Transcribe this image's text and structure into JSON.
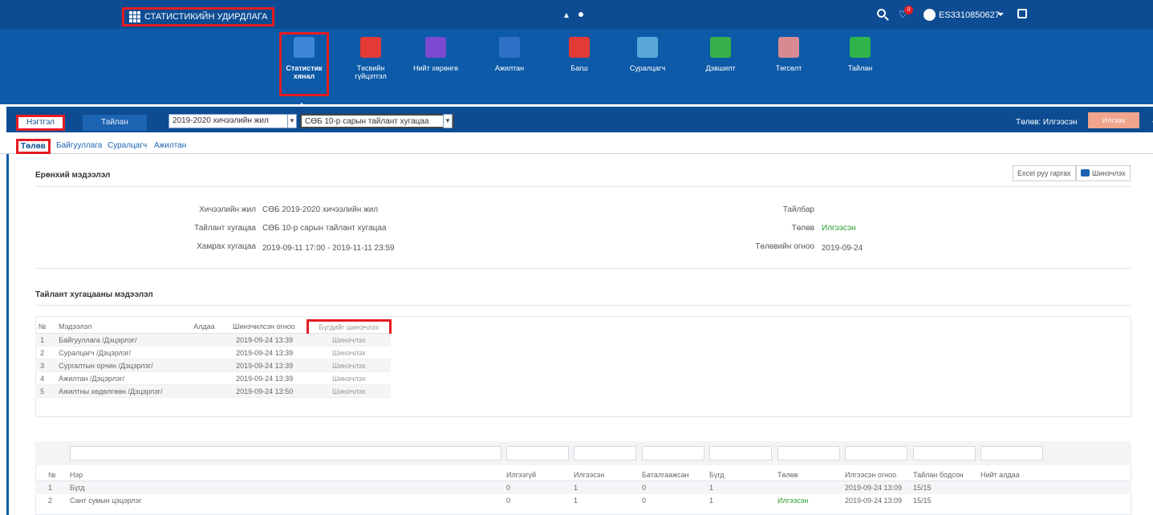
{
  "topbar": {
    "brand": "СТАТИСТИКИЙН УДИРДЛАГА",
    "badge": "0",
    "user": "ES3310850627"
  },
  "apps": [
    {
      "label": "Статистик хянал",
      "color": "#3f86d8",
      "active": true
    },
    {
      "label": "Төсвийн гүйцэтгэл",
      "color": "#e33a35"
    },
    {
      "label": "Нийт хөрөнгө",
      "color": "#7b4ad1"
    },
    {
      "label": "Ажилтан",
      "color": "#2f6fc6"
    },
    {
      "label": "Багш",
      "color": "#e33a35"
    },
    {
      "label": "Суралцагч",
      "color": "#5aa6d8"
    },
    {
      "label": "Дэвшилт",
      "color": "#38b049"
    },
    {
      "label": "Төгсөлт",
      "color": "#d88a92"
    },
    {
      "label": "Тайлан",
      "color": "#2fb44b"
    }
  ],
  "tabbar": {
    "tab_main": "Нэгтгэл",
    "tab_report": "Тайлан",
    "year_select": "2019-2020 хичээлийн жил",
    "period_select": "СӨБ 10-р сарын тайлант хугацаа",
    "status": "Төлөв: Илгээсэн",
    "submit": "Илгээх"
  },
  "subtabs": [
    "Төлөв",
    "Байгууллага",
    "Суралцагч",
    "Ажилтан"
  ],
  "general": {
    "title": "Ерөнхий мэдээлэл",
    "excel_button": "Excel руу гаргах",
    "refresh_button": "Шинэчлэх",
    "left": [
      {
        "label": "Хичээлийн жил",
        "value": "СӨБ 2019-2020 хичээлийн жил"
      },
      {
        "label": "Тайлант хугацаа",
        "value": "СӨБ 10-р сарын тайлант хугацаа"
      },
      {
        "label": "Хамрах хугацаа",
        "value": "2019-09-11 17:00 - 2019-11-11 23:59"
      }
    ],
    "right": [
      {
        "label": "Тайлбар",
        "value": ""
      },
      {
        "label": "Төлөв",
        "value": "Илгээсэн"
      },
      {
        "label": "Төлөвийн огноо",
        "value": "2019-09-24"
      }
    ]
  },
  "period_info": {
    "title": "Тайлант хугацааны мэдээлэл",
    "headers": [
      "№",
      "Мэдээлэл",
      "Алдаа",
      "Шинэчилсэн огноо",
      "Бүгдийг шинэчлэх"
    ],
    "rows": [
      {
        "no": "1",
        "name": "Байгууллага /Дэцэрлэг/",
        "err": "",
        "date": "2019-09-24 13:39",
        "action": "Шинэчлэх"
      },
      {
        "no": "2",
        "name": "Суралцагч /Дэцэрлэг/",
        "err": "",
        "date": "2019-09-24 13:39",
        "action": "Шинэчлэх"
      },
      {
        "no": "3",
        "name": "Сургалтын орчин /Дэцэрлэг/",
        "err": "",
        "date": "2019-09-24 13:39",
        "action": "Шинэчлэх"
      },
      {
        "no": "4",
        "name": "Ажилтан /Дэцэрлэг/",
        "err": "",
        "date": "2019-09-24 13:39",
        "action": "Шинэчлэх"
      },
      {
        "no": "5",
        "name": "Ажилтны хөдөлгөөн /Дэцэрлэг/",
        "err": "",
        "date": "2019-09-24 13:50",
        "action": "Шинэчлэх"
      }
    ]
  },
  "summary": {
    "headers": [
      "№",
      "Нэр",
      "Илгээгүй",
      "Илгээсэн",
      "Баталгаажсан",
      "Бүгд",
      "Төлөв",
      "Илгээсэн огноо",
      "Тайлан бодсон",
      "Нийт алдаа"
    ],
    "rows": [
      [
        "1",
        "Бүгд",
        "0",
        "1",
        "0",
        "1",
        "",
        "2019-09-24 13:09",
        "15/15",
        ""
      ],
      [
        "2",
        "Сант сумын цэцэрлэг",
        "0",
        "1",
        "0",
        "1",
        "Илгээсэн",
        "2019-09-24 13:09",
        "15/15",
        ""
      ]
    ]
  }
}
